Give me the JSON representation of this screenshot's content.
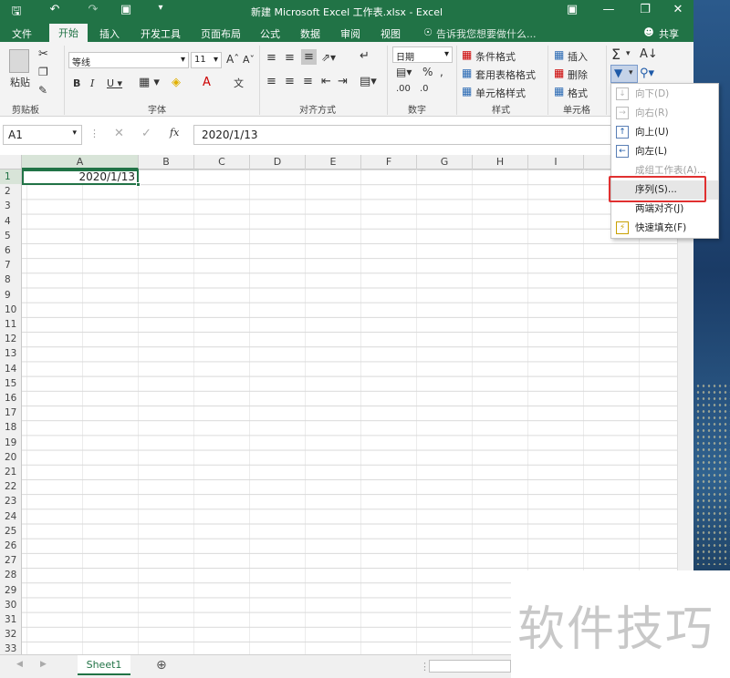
{
  "window": {
    "title": "新建 Microsoft Excel 工作表.xlsx - Excel"
  },
  "tabs": [
    "文件",
    "开始",
    "插入",
    "开发工具",
    "页面布局",
    "公式",
    "数据",
    "审阅",
    "视图"
  ],
  "tell_me": "告诉我您想要做什么...",
  "share": "共享",
  "ribbon": {
    "paste": "粘贴",
    "clipboard": "剪贴板",
    "font_name": "等线",
    "font_size": "11",
    "font_group": "字体",
    "align_group": "对齐方式",
    "number_format": "日期",
    "number_group": "数字",
    "cond_format": "条件格式",
    "table_format": "套用表格格式",
    "cell_style": "单元格样式",
    "styles_group": "样式",
    "insert": "插入",
    "delete": "删除",
    "format": "格式",
    "cells_group": "单元格"
  },
  "formula_bar": {
    "name_box": "A1",
    "fx": "fx",
    "value": "2020/1/13"
  },
  "columns": [
    "A",
    "B",
    "C",
    "D",
    "E",
    "F",
    "G",
    "H",
    "I"
  ],
  "rows": [
    "1",
    "2",
    "3",
    "4",
    "5",
    "6",
    "7",
    "8",
    "9",
    "10",
    "11",
    "12",
    "13",
    "14",
    "15",
    "16",
    "17",
    "18",
    "19",
    "20",
    "21",
    "22",
    "23",
    "24",
    "25",
    "26",
    "27",
    "28",
    "29",
    "30",
    "31",
    "32",
    "33"
  ],
  "cells": {
    "A1": "2020/1/13"
  },
  "sheet": {
    "name": "Sheet1"
  },
  "fill_menu": [
    {
      "label": "向下(D)",
      "disabled": true
    },
    {
      "label": "向右(R)",
      "disabled": true
    },
    {
      "label": "向上(U)",
      "disabled": false
    },
    {
      "label": "向左(L)",
      "disabled": false
    },
    {
      "label": "成组工作表(A)...",
      "disabled": true
    },
    {
      "label": "序列(S)...",
      "disabled": false
    },
    {
      "label": "两端对齐(J)",
      "disabled": false
    },
    {
      "label": "快速填充(F)",
      "disabled": false
    }
  ],
  "watermark": "软件技巧",
  "colors": {
    "excel_green": "#217346",
    "highlight": "#e03030"
  }
}
